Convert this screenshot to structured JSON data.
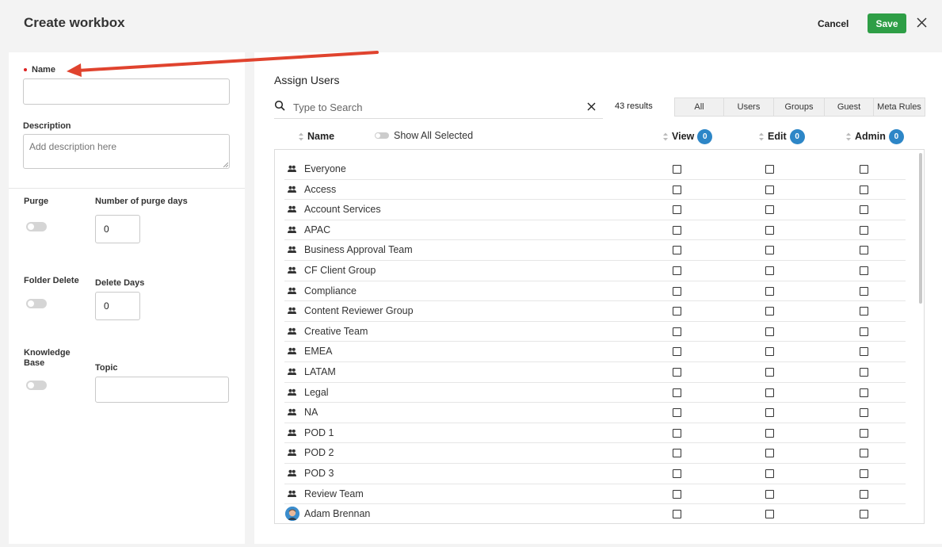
{
  "header": {
    "title": "Create workbox",
    "cancel_label": "Cancel",
    "save_label": "Save",
    "save_color": "#2e9e46"
  },
  "form": {
    "name_label": "Name",
    "name_value": "",
    "description_label": "Description",
    "description_placeholder": "Add description here",
    "purge_label": "Purge",
    "purge_days_label": "Number of purge days",
    "purge_days_value": "0",
    "folder_delete_label": "Folder Delete",
    "delete_days_label": "Delete Days",
    "delete_days_value": "0",
    "knowledge_base_label": "Knowledge Base",
    "topic_label": "Topic",
    "topic_value": ""
  },
  "assign": {
    "title": "Assign Users",
    "search_placeholder": "Type to Search",
    "results": "43 results",
    "filters": [
      "All",
      "Users",
      "Groups",
      "Guest",
      "Meta Rules"
    ],
    "columns": {
      "name": "Name",
      "show_all_selected": "Show All Selected",
      "view": "View",
      "view_count": "0",
      "edit": "Edit",
      "edit_count": "0",
      "admin": "Admin",
      "admin_count": "0"
    },
    "badge_color": "#2d86c7",
    "rows": [
      {
        "name": "Everyone",
        "type": "group-icon"
      },
      {
        "name": "Access",
        "type": "group-icon"
      },
      {
        "name": "Account Services",
        "type": "group-icon"
      },
      {
        "name": "APAC",
        "type": "group-icon"
      },
      {
        "name": "Business Approval Team",
        "type": "group-icon"
      },
      {
        "name": "CF Client Group",
        "type": "group-icon"
      },
      {
        "name": "Compliance",
        "type": "group-icon"
      },
      {
        "name": "Content Reviewer Group",
        "type": "group-icon"
      },
      {
        "name": "Creative Team",
        "type": "group-icon"
      },
      {
        "name": "EMEA",
        "type": "group-icon"
      },
      {
        "name": "LATAM",
        "type": "group-icon"
      },
      {
        "name": "Legal",
        "type": "group-icon"
      },
      {
        "name": "NA",
        "type": "group-icon"
      },
      {
        "name": "POD 1",
        "type": "group-icon"
      },
      {
        "name": "POD 2",
        "type": "group-icon"
      },
      {
        "name": "POD 3",
        "type": "group-icon"
      },
      {
        "name": "Review Team",
        "type": "group-icon"
      },
      {
        "name": "Adam Brennan",
        "type": "avatar"
      }
    ]
  }
}
